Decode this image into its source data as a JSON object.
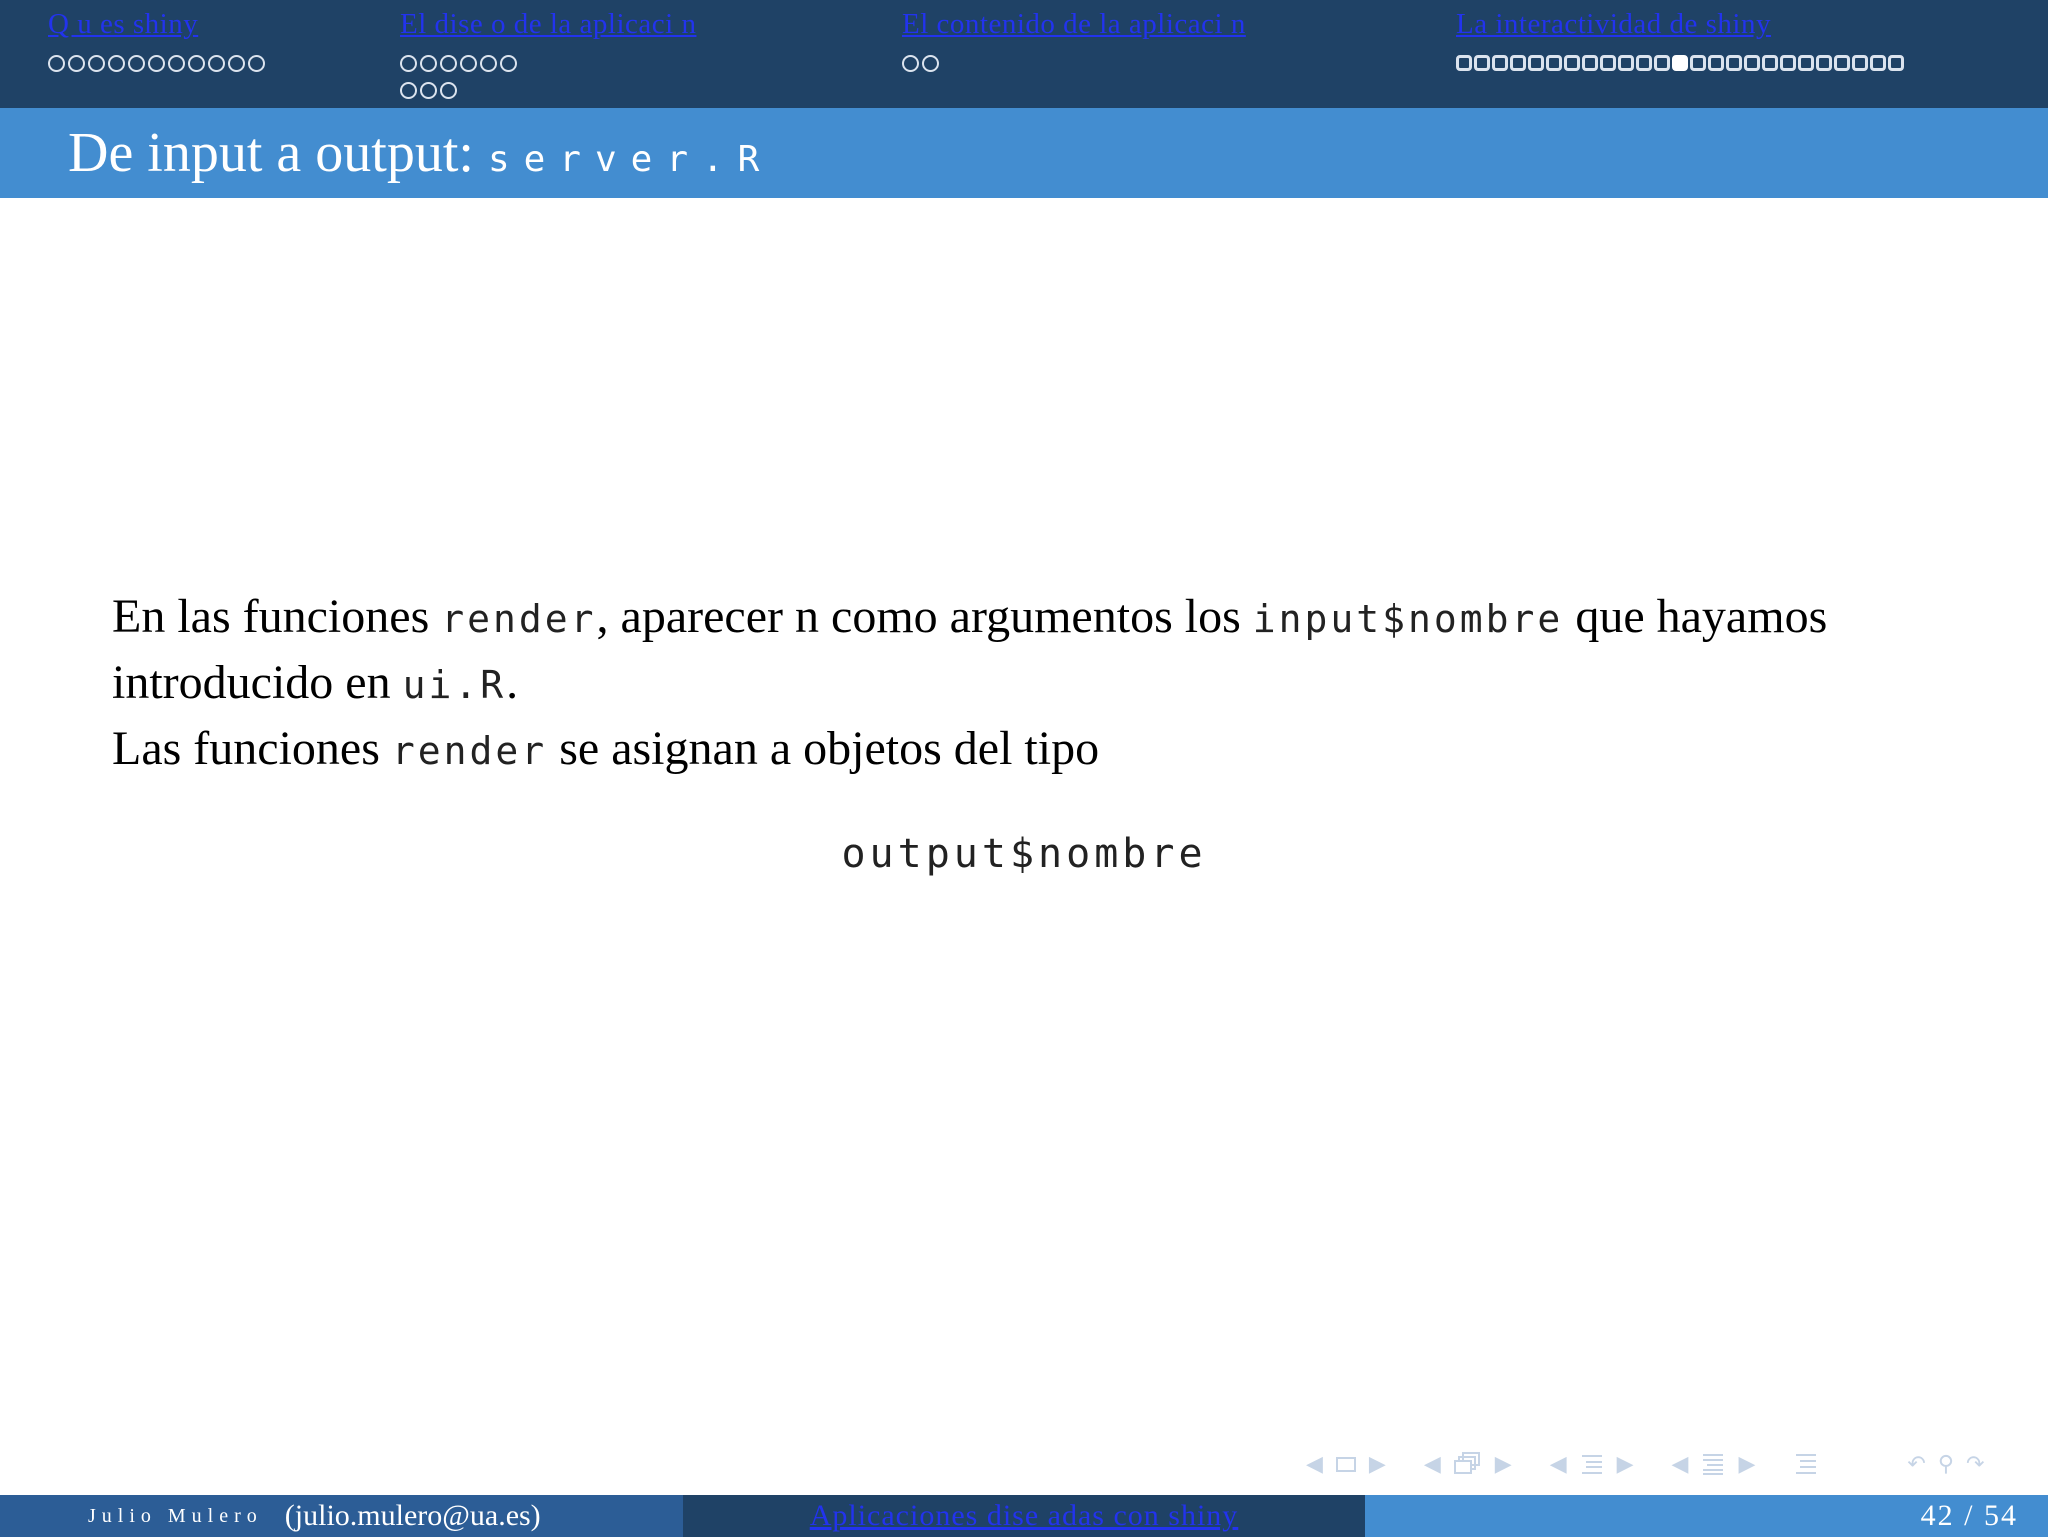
{
  "nav": {
    "sections": [
      {
        "label": "Q u   es shiny",
        "dot_rows": [
          11
        ]
      },
      {
        "label": "El dise o de la aplicaci n",
        "dot_rows": [
          6,
          3
        ]
      },
      {
        "label": "El contenido de la aplicaci n",
        "dot_rows": [
          2
        ]
      },
      {
        "label": "La interactividad de shiny",
        "dot_rows": [
          25
        ],
        "current_index": 12
      }
    ]
  },
  "frame": {
    "title": "De input a output:",
    "title_code": "server.R"
  },
  "body": {
    "p1_a": "En las funciones ",
    "p1_code1": "render",
    "p1_b": ", aparecer n como argumentos los ",
    "p1_code2": "input$nombre",
    "p1_c": " que hayamos introducido en ",
    "p1_code3": "ui.R",
    "p1_d": ".",
    "p2_a": "Las funciones ",
    "p2_code": "render",
    "p2_b": " se asignan a objetos del tipo",
    "display_code": "output$nombre"
  },
  "footer": {
    "author": "Julio Mulero",
    "email": "(julio.mulero@ua.es)",
    "title": "Aplicaciones dise adas con shiny",
    "page": "42 / 54"
  },
  "colors": {
    "nav_bg": "#1f4266",
    "title_bg": "#438dd0",
    "link": "#2233ee",
    "footer_left_bg": "#2c5d96"
  },
  "icons": [
    "arrow-left-icon",
    "frame-icon",
    "arrow-right-icon",
    "subsection-icon",
    "section-icon",
    "list-icon",
    "back-icon",
    "search-icon",
    "forward-icon"
  ]
}
